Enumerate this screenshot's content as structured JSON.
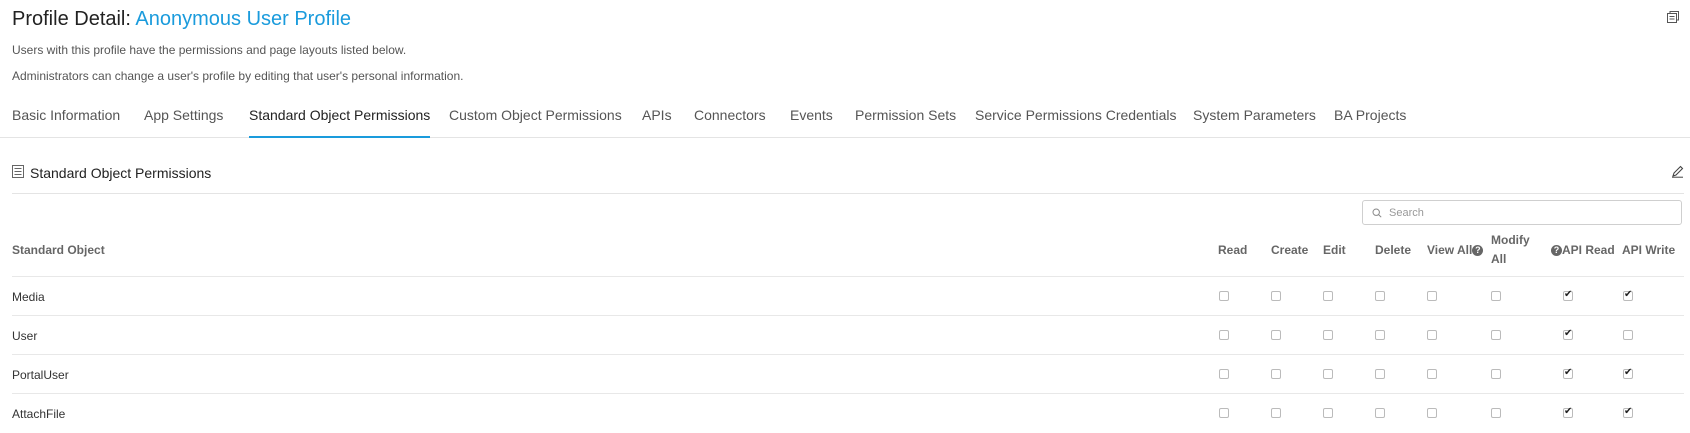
{
  "header": {
    "title_prefix": "Profile Detail:",
    "title_name": "Anonymous User Profile",
    "desc1": "Users with this profile have the permissions and page layouts listed below.",
    "desc2": "Administrators can change a user's profile by editing that user's personal information."
  },
  "tabs": [
    {
      "label": "Basic Information"
    },
    {
      "label": "App Settings"
    },
    {
      "label": "Standard Object Permissions",
      "active": true
    },
    {
      "label": "Custom Object Permissions"
    },
    {
      "label": "APIs"
    },
    {
      "label": "Connectors"
    },
    {
      "label": "Events"
    },
    {
      "label": "Permission Sets"
    },
    {
      "label": "Service Permissions Credentials"
    },
    {
      "label": "System Parameters"
    },
    {
      "label": "BA Projects"
    }
  ],
  "section": {
    "title": "Standard Object Permissions"
  },
  "search": {
    "placeholder": "Search",
    "value": ""
  },
  "table": {
    "headers": {
      "object": "Standard Object",
      "read": "Read",
      "create": "Create",
      "edit": "Edit",
      "delete": "Delete",
      "view_all": "View All",
      "modify_all": "Modify All",
      "api_read": "API Read",
      "api_write": "API Write"
    },
    "rows": [
      {
        "name": "Media",
        "read": false,
        "create": false,
        "edit": false,
        "delete": false,
        "view_all": false,
        "modify_all": false,
        "api_read": true,
        "api_write": true
      },
      {
        "name": "User",
        "read": false,
        "create": false,
        "edit": false,
        "delete": false,
        "view_all": false,
        "modify_all": false,
        "api_read": true,
        "api_write": false
      },
      {
        "name": "PortalUser",
        "read": false,
        "create": false,
        "edit": false,
        "delete": false,
        "view_all": false,
        "modify_all": false,
        "api_read": true,
        "api_write": true
      },
      {
        "name": "AttachFile",
        "read": false,
        "create": false,
        "edit": false,
        "delete": false,
        "view_all": false,
        "modify_all": false,
        "api_read": true,
        "api_write": true
      }
    ]
  },
  "icons": {
    "corner": "window-restore-icon",
    "section": "list-icon",
    "edit": "pencil-icon",
    "search": "search-icon",
    "help": "question-circle-icon"
  },
  "colors": {
    "accent": "#1a9bdc"
  }
}
